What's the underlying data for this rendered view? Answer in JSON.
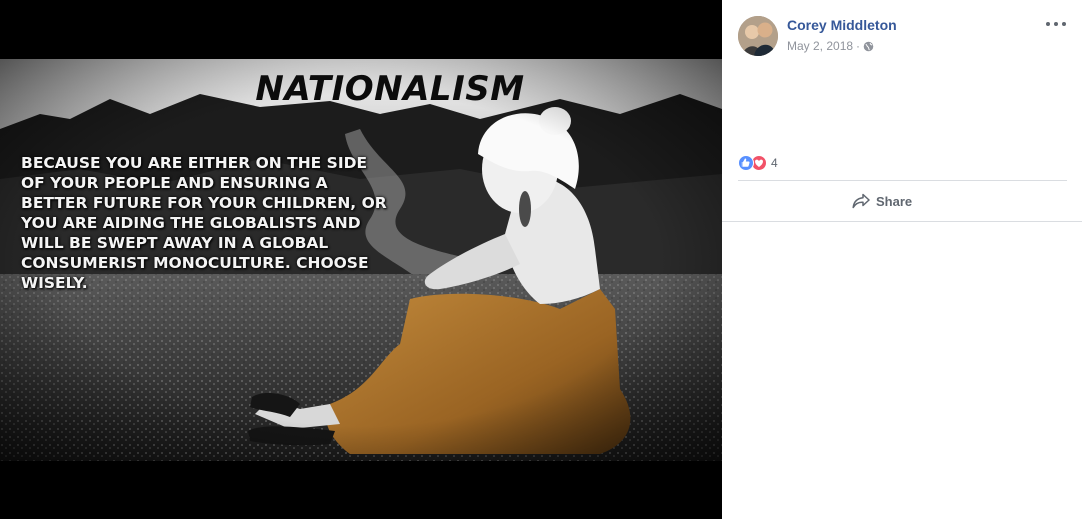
{
  "photo": {
    "headline": "NATIONALISM",
    "caption": "Because you are either on the side of your people and ensuring a better future for your children, or you are aiding the globalists and will be swept away in a global consumerist monoculture. Choose wisely."
  },
  "post": {
    "author": "Corey Middleton",
    "date": "May 2, 2018",
    "separator": "·",
    "privacy_icon": "globe-icon",
    "options_icon": "more-icon"
  },
  "reactions": {
    "icons": [
      "like-icon",
      "love-icon"
    ],
    "count": "4"
  },
  "actions": {
    "share_label": "Share",
    "share_icon": "share-icon"
  },
  "colors": {
    "link": "#365899",
    "meta": "#90949c",
    "like": "#5890ff",
    "love": "#f25268",
    "dress": "#a8752e"
  }
}
